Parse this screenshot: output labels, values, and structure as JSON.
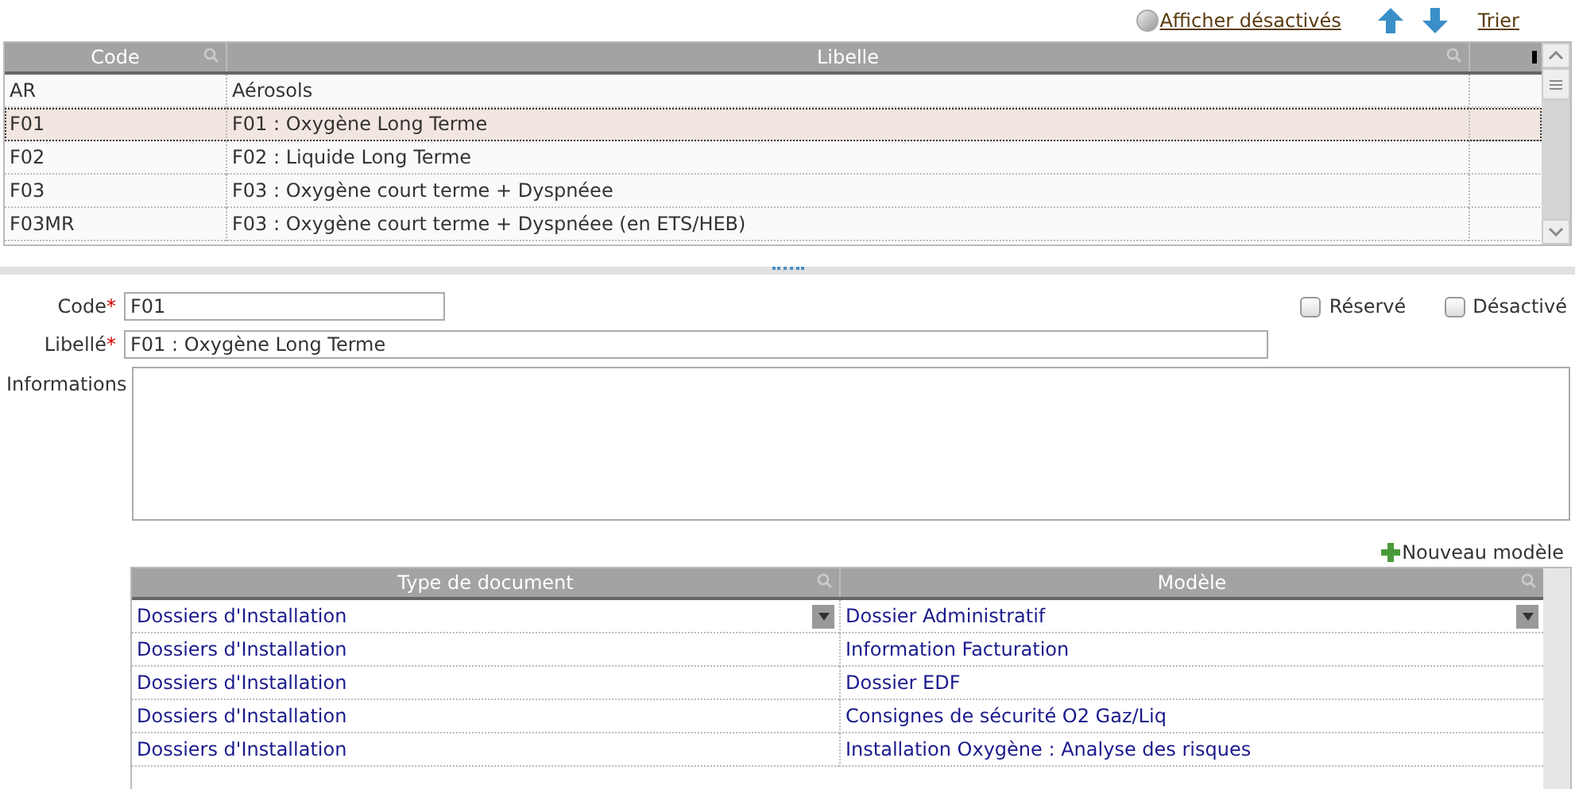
{
  "toolbar": {
    "show_disabled": "Afficher désactivés",
    "sort": "Trier"
  },
  "main_grid": {
    "columns": [
      "Code",
      "Libelle"
    ],
    "rows": [
      {
        "code": "AR",
        "label": "Aérosols",
        "selected": false
      },
      {
        "code": "F01",
        "label": "F01 : Oxygène Long Terme",
        "selected": true
      },
      {
        "code": "F02",
        "label": "F02 : Liquide Long Terme",
        "selected": false
      },
      {
        "code": "F03",
        "label": "F03 : Oxygène court terme + Dyspnéee",
        "selected": false
      },
      {
        "code": "F03MR",
        "label": "F03 : Oxygène court terme + Dyspnéee (en ETS/HEB)",
        "selected": false
      }
    ]
  },
  "form": {
    "code": {
      "label": "Code",
      "required_mark": "*",
      "value": "F01"
    },
    "libelle": {
      "label": "Libellé",
      "required_mark": "*",
      "value": "F01 : Oxygène Long Terme"
    },
    "informations": {
      "label": "Informations"
    },
    "checkboxes": [
      {
        "label": "Réservé",
        "checked": false
      },
      {
        "label": "Désactivé",
        "checked": false
      }
    ]
  },
  "documents": {
    "new_button": "Nouveau modèle",
    "columns": [
      "Type de document",
      "Modèle"
    ],
    "rows": [
      {
        "type": "Dossiers d'Installation",
        "model": "Dossier Administratif",
        "editing": true
      },
      {
        "type": "Dossiers d'Installation",
        "model": "Information Facturation",
        "editing": false
      },
      {
        "type": "Dossiers d'Installation",
        "model": "Dossier EDF",
        "editing": false
      },
      {
        "type": "Dossiers d'Installation",
        "model": "Consignes de sécurité O2 Gaz/Liq",
        "editing": false
      },
      {
        "type": "Dossiers d'Installation",
        "model": "Installation Oxygène : Analyse des risques",
        "editing": false
      }
    ]
  }
}
